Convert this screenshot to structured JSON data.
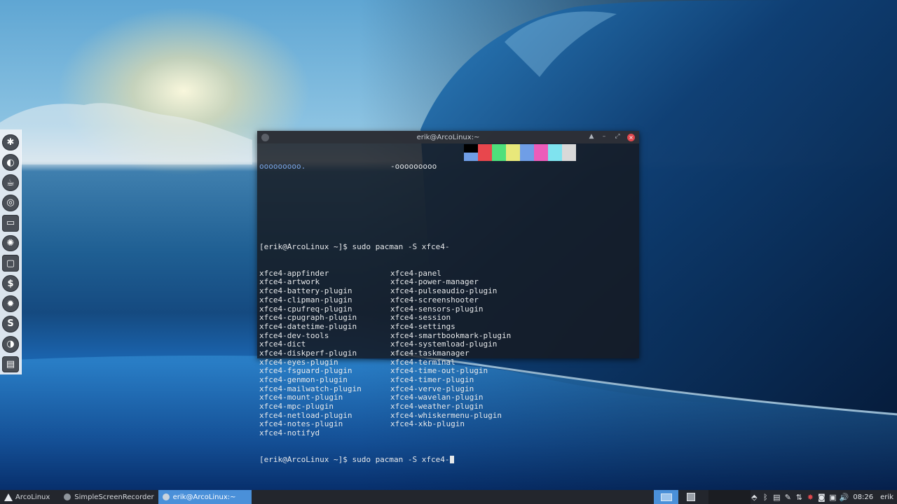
{
  "terminal": {
    "title": "erik@ArcoLinux:~",
    "header_left": "ooooooooo.",
    "header_right": "-ooooooooo",
    "swatch_colors": [
      "#000000",
      "#e8474d",
      "#4fe07b",
      "#e8e87a",
      "#6f9ee6",
      "#ec5cba",
      "#7fe3ef",
      "#d9d9d9",
      "#6f9ee6",
      "#e8474d",
      "#4fe07b",
      "#e8e87a",
      "#6f9ee6",
      "#ec5cba",
      "#7fe3ef",
      "#d9d9d9"
    ],
    "prompt": "[erik@ArcoLinux ~]$ sudo pacman -S xfce4-",
    "completions_left": [
      "xfce4-appfinder",
      "xfce4-artwork",
      "xfce4-battery-plugin",
      "xfce4-clipman-plugin",
      "xfce4-cpufreq-plugin",
      "xfce4-cpugraph-plugin",
      "xfce4-datetime-plugin",
      "xfce4-dev-tools",
      "xfce4-dict",
      "xfce4-diskperf-plugin",
      "xfce4-eyes-plugin",
      "xfce4-fsguard-plugin",
      "xfce4-genmon-plugin",
      "xfce4-mailwatch-plugin",
      "xfce4-mount-plugin",
      "xfce4-mpc-plugin",
      "xfce4-netload-plugin",
      "xfce4-notes-plugin",
      "xfce4-notifyd"
    ],
    "completions_right": [
      "xfce4-panel",
      "xfce4-power-manager",
      "xfce4-pulseaudio-plugin",
      "xfce4-screenshooter",
      "xfce4-sensors-plugin",
      "xfce4-session",
      "xfce4-settings",
      "xfce4-smartbookmark-plugin",
      "xfce4-systemload-plugin",
      "xfce4-taskmanager",
      "xfce4-terminal",
      "xfce4-time-out-plugin",
      "xfce4-timer-plugin",
      "xfce4-verve-plugin",
      "xfce4-wavelan-plugin",
      "xfce4-weather-plugin",
      "xfce4-whiskermenu-plugin",
      "xfce4-xkb-plugin",
      ""
    ]
  },
  "dock": {
    "items": [
      {
        "name": "app-menu-icon",
        "glyph": "✱"
      },
      {
        "name": "file-manager-icon",
        "glyph": "◐"
      },
      {
        "name": "teapot-icon",
        "glyph": "☕"
      },
      {
        "name": "browser-icon",
        "glyph": "◎"
      },
      {
        "name": "files-icon",
        "glyph": "▭"
      },
      {
        "name": "camera-aperture-icon",
        "glyph": "✺"
      },
      {
        "name": "window-icon",
        "glyph": "▢"
      },
      {
        "name": "terminal-icon",
        "glyph": "$"
      },
      {
        "name": "settings-icon",
        "glyph": "✹"
      },
      {
        "name": "skype-icon",
        "glyph": "S"
      },
      {
        "name": "firefox-icon",
        "glyph": "◑"
      },
      {
        "name": "drive-icon",
        "glyph": "▤"
      }
    ]
  },
  "taskbar": {
    "menu_label": "ArcoLinux",
    "tasks": [
      {
        "label": "SimpleScreenRecorder",
        "active": false
      },
      {
        "label": "erik@ArcoLinux:~",
        "active": true
      }
    ],
    "tray_icons": [
      "dropbox-icon",
      "bluetooth-icon",
      "clipboard-icon",
      "pencil-icon",
      "network-icon",
      "update-icon",
      "screenshot-icon",
      "image-icon",
      "volume-icon"
    ],
    "clock": "08:26",
    "user": "erik"
  }
}
